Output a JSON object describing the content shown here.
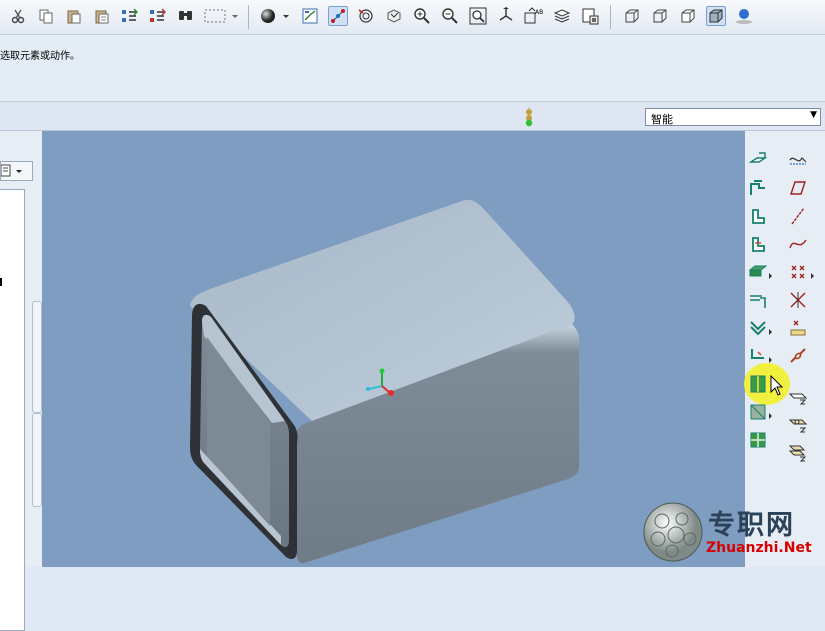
{
  "message_line": "选取元素或动作。",
  "filter": {
    "selected": "智能",
    "arrow": "▼"
  },
  "watermark": {
    "chinese": "专职网",
    "domain": "Zhuanzhi.Net"
  },
  "colors": {
    "viewport_background": "#7e9dc0",
    "part_surface": "#9fb1c3",
    "highlight": "#f2ef2a"
  },
  "toolbar_icons": [
    "cut-icon",
    "copy-icon",
    "paste-icon",
    "paste-special-icon",
    "regenerate-icon",
    "regenerate-manager-icon",
    "find-icon",
    "select-box-icon",
    "display-style-icon",
    "saved-views-icon",
    "datum-planes-icon",
    "datum-axes-icon",
    "datum-points-icon",
    "zoom-in-icon",
    "zoom-out-icon",
    "refit-icon",
    "reorient-icon",
    "spin-center-icon",
    "layers-icon",
    "view-manager-icon",
    "wireframe-icon",
    "hidden-line-icon",
    "no-hidden-icon",
    "shading-icon",
    "appearance-icon"
  ],
  "right_toolbar_icons": [
    "flat-wall-icon",
    "datum-plane-icon",
    "flange-wall-icon",
    "sketch-plane-icon",
    "extrude-wall-icon",
    "datum-axis-icon",
    "revolve-wall-icon",
    "datum-curve-icon",
    "blend-wall-icon",
    "datum-point-icon",
    "bend-icon",
    "coordinate-system-icon",
    "unbend-icon",
    "analysis-icon",
    "edge-rip-icon",
    "chain-icon",
    "rip-icon",
    "tool-a-icon",
    "corner-relief-icon",
    "tool-b-icon",
    "form-icon",
    "tool-c-icon"
  ]
}
